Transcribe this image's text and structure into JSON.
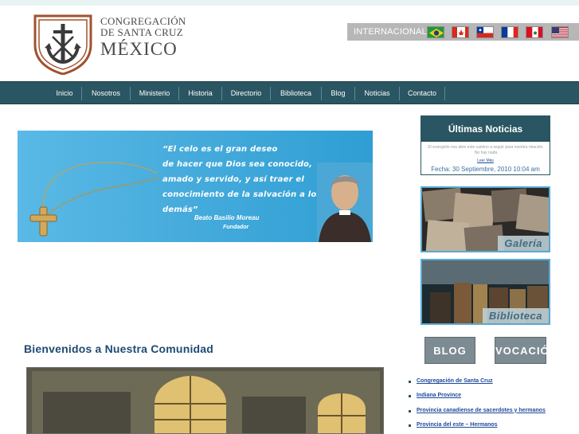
{
  "header": {
    "logo_line1": "CONGREGACIÓN",
    "logo_line2": "DE SANTA CRUZ",
    "logo_line3": "MÉXICO"
  },
  "language_bar": {
    "label": "INTERNACIONAL",
    "flags": [
      "brazil-flag",
      "canada-flag",
      "chile-flag",
      "france-flag",
      "peru-flag",
      "usa-flag"
    ]
  },
  "nav": {
    "items": [
      "Inicio",
      "Nosotros",
      "Ministerio",
      "Historia",
      "Directorio",
      "Biblioteca",
      "Blog",
      "Noticias",
      "Contacto"
    ]
  },
  "banner": {
    "quote_line1": "“El celo es el gran deseo",
    "quote_line2": "de hacer que Dios sea conocido,",
    "quote_line3": "amado y servido, y así traer el",
    "quote_line4": "conocimiento de la salvación a los",
    "quote_line5": "demás”",
    "author": "Beato Basilio Moreau",
    "role": "Fundador"
  },
  "main": {
    "welcome_title": "Bienvenidos a Nuestra Comunidad"
  },
  "sidebar": {
    "news": {
      "title": "Últimas Noticias",
      "excerpt": "El evangelio nos abre este camino a seguir para nuestra relación. No hay nada",
      "more": "Leer Más",
      "date": "Fecha: 30 Septiembre, 2010 10:04 am"
    },
    "gallery_label": "Galería",
    "library_label": "Biblioteca",
    "blog_button": "BLOG",
    "vocacion_button": "VOCACIÓN",
    "links": [
      "Congregación de Santa Cruz",
      "Indiana Province",
      "Provincia canadiense de sacerdotes y hermanos",
      "Provincia del este – Hermanos"
    ]
  },
  "colors": {
    "nav_bg": "#2a5562",
    "title_blue": "#1f4a73",
    "logo_brown": "#a0522d",
    "banner_blue": "#47acdc"
  }
}
